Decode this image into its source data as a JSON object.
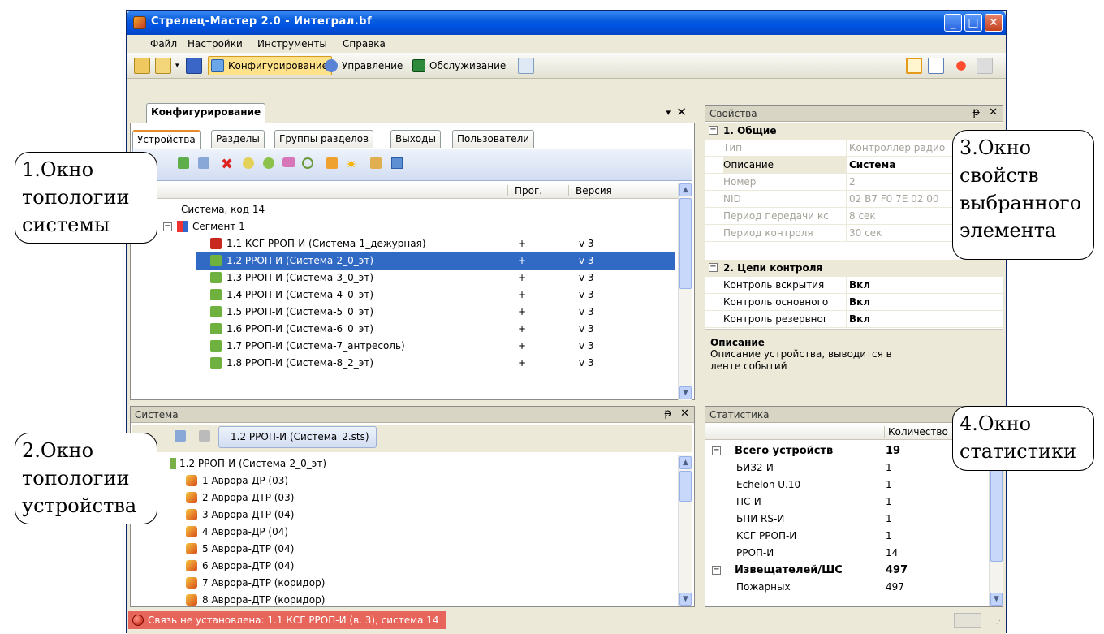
{
  "window": {
    "title": "Стрелец-Мастер 2.0 - Интеграл.bf"
  },
  "menu": [
    "Файл",
    "Настройки",
    "Инструменты",
    "Справка"
  ],
  "toolbar": {
    "configure": "Конфигурирование",
    "manage": "Управление",
    "service": "Обслуживание"
  },
  "config_pane": {
    "title": "Конфигурирование",
    "tabs": [
      "Устройства",
      "Разделы",
      "Группы разделов",
      "Выходы",
      "Пользователи"
    ],
    "columns": {
      "prog": "Прог.",
      "version": "Версия"
    },
    "system_node": "Система, код 14",
    "segment_node": "Сегмент 1",
    "devices": [
      {
        "name": "1.1 КСГ РРОП-И (Система-1_дежурная)",
        "prog": "+",
        "ver": "v 3"
      },
      {
        "name": "1.2 РРОП-И (Система-2_0_эт)",
        "prog": "+",
        "ver": "v 3"
      },
      {
        "name": "1.3 РРОП-И (Система-3_0_эт)",
        "prog": "+",
        "ver": "v 3"
      },
      {
        "name": "1.4 РРОП-И (Система-4_0_эт)",
        "prog": "+",
        "ver": "v 3"
      },
      {
        "name": "1.5 РРОП-И (Система-5_0_эт)",
        "prog": "+",
        "ver": "v 3"
      },
      {
        "name": "1.6 РРОП-И (Система-6_0_эт)",
        "prog": "+",
        "ver": "v 3"
      },
      {
        "name": "1.7 РРОП-И (Система-7_антресоль)",
        "prog": "+",
        "ver": "v 3"
      },
      {
        "name": "1.8 РРОП-И (Система-8_2_эт)",
        "prog": "+",
        "ver": "v 3"
      }
    ]
  },
  "props_pane": {
    "title": "Свойства",
    "cat1": "1. Общие",
    "rows1": [
      {
        "k": "Тип",
        "v": "Контроллер радио"
      },
      {
        "k": "Описание",
        "v": "Система"
      },
      {
        "k": "Номер",
        "v": "2"
      },
      {
        "k": "NID",
        "v": "02 B7 F0 7E 02 00"
      },
      {
        "k": "Период передачи кс",
        "v": "8 сек"
      },
      {
        "k": "Период контроля",
        "v": "30 сек"
      }
    ],
    "cat2": "2. Цепи контроля",
    "rows2": [
      {
        "k": "Контроль вскрытия",
        "v": "Вкл"
      },
      {
        "k": "Контроль основного",
        "v": "Вкл"
      },
      {
        "k": "Контроль резервног",
        "v": "Вкл"
      }
    ],
    "desc_title": "Описание",
    "desc_text": "Описание устройства, выводится в ленте событий"
  },
  "system_pane": {
    "title": "Система",
    "file_tab": "1.2 РРОП-И (Система_2.sts)",
    "root": "1.2 РРОП-И (Система-2_0_эт)",
    "items": [
      "1 Аврора-ДР (03)",
      "2 Аврора-ДТР (03)",
      "3 Аврора-ДТР (04)",
      "4 Аврора-ДР (04)",
      "5 Аврора-ДТР (04)",
      "6 Аврора-ДТР (04)",
      "7 Аврора-ДТР (коридор)",
      "8 Аврора-ДТР (коридор)"
    ]
  },
  "stats_pane": {
    "title": "Статистика",
    "col": "Количество",
    "rows": [
      {
        "k": "Всего устройств",
        "v": "19",
        "bold": true
      },
      {
        "k": "БИЗ2-И",
        "v": "1"
      },
      {
        "k": "Echelon U.10",
        "v": "1"
      },
      {
        "k": "ПС-И",
        "v": "1"
      },
      {
        "k": "БПИ RS-И",
        "v": "1"
      },
      {
        "k": "КСГ РРОП-И",
        "v": "1"
      },
      {
        "k": "РРОП-И",
        "v": "14"
      },
      {
        "k": "Извещателей/ШС",
        "v": "497",
        "bold": true
      },
      {
        "k": "Пожарных",
        "v": "497"
      }
    ]
  },
  "status": {
    "message": "Связь не установлена: 1.1 КСГ РРОП-И (в. 3), система 14"
  },
  "callouts": {
    "c1": "1.Окно топологии системы",
    "c2": "2.Окно топологии устройства",
    "c3": "3.Окно свойств выбранного элемента",
    "c4": "4.Окно статистики"
  }
}
